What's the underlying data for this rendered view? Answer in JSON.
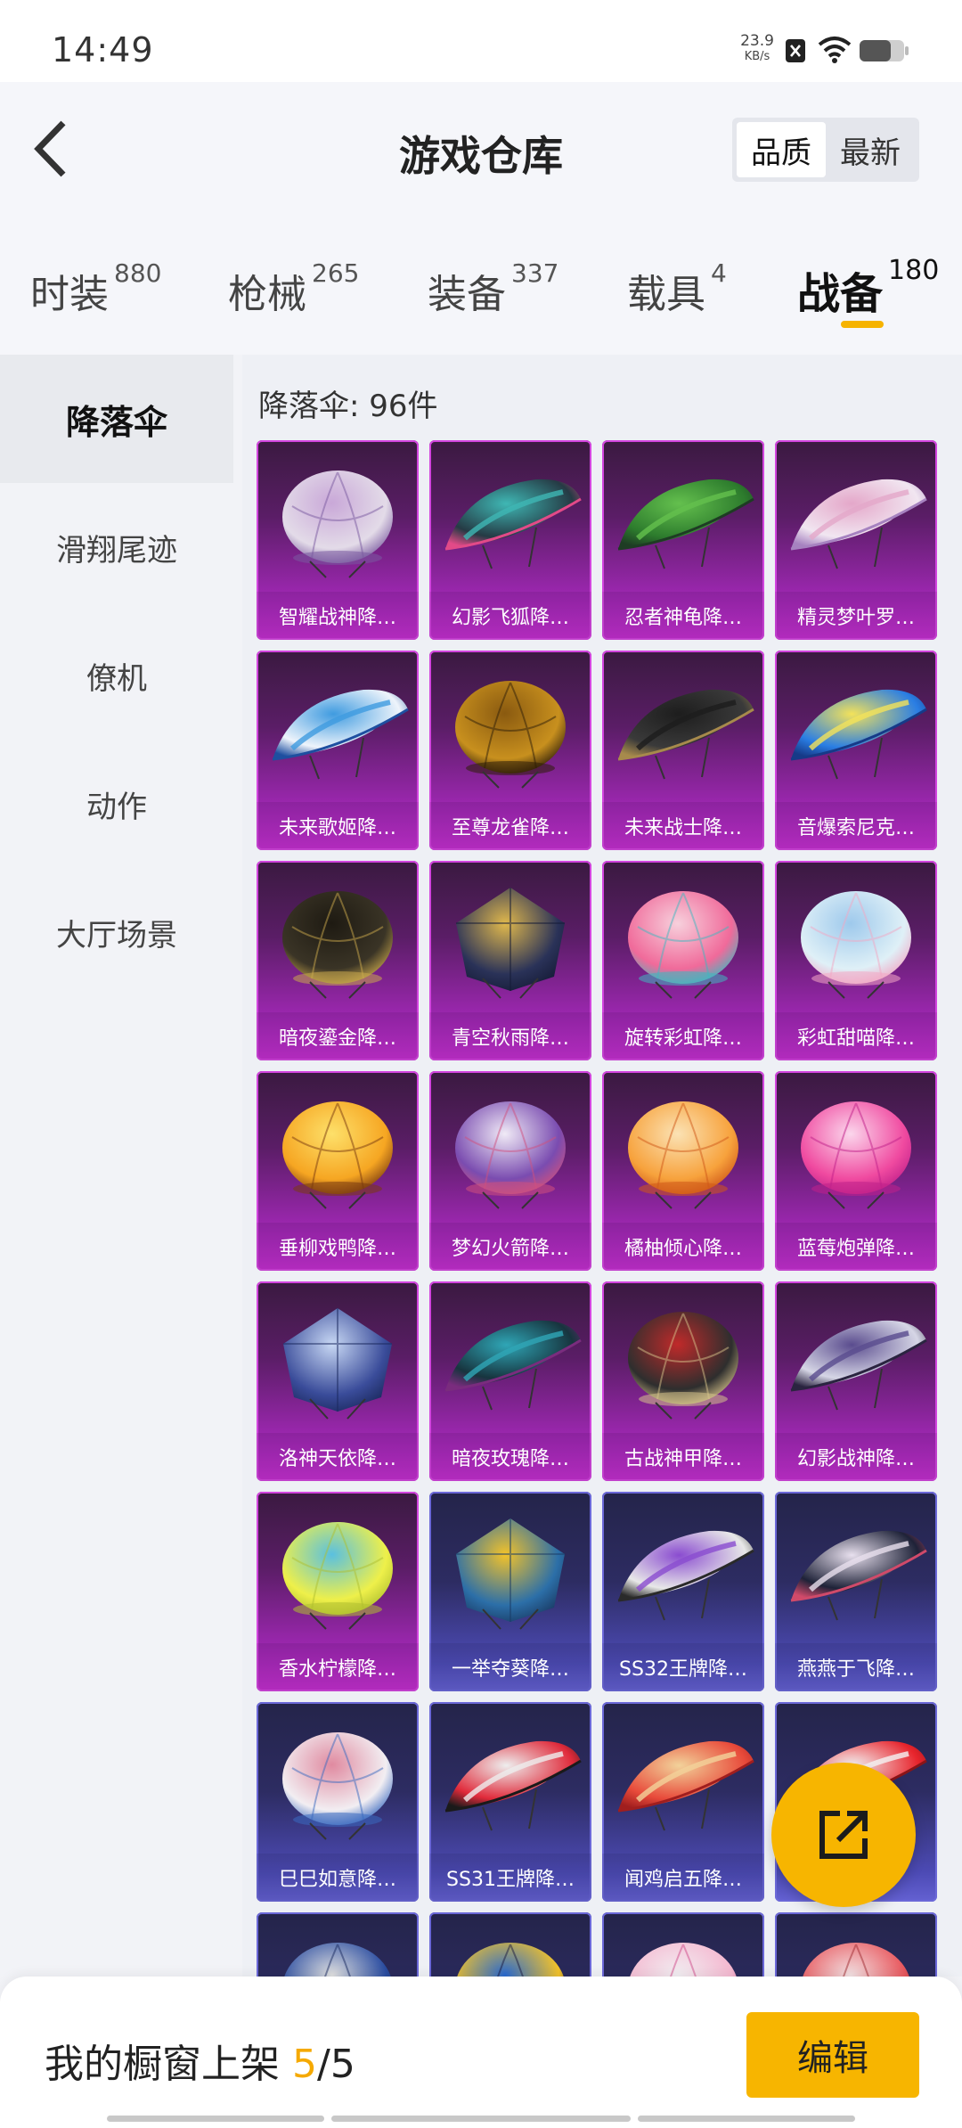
{
  "status_bar": {
    "time": "14:49",
    "net_speed_value": "23.9",
    "net_speed_unit": "KB/s",
    "battery_level": 0.7
  },
  "header": {
    "title": "游戏仓库",
    "sort_options": [
      "品质",
      "最新"
    ],
    "sort_active": "品质"
  },
  "tabs": [
    {
      "label": "时装",
      "count": "880"
    },
    {
      "label": "枪械",
      "count": "265"
    },
    {
      "label": "装备",
      "count": "337"
    },
    {
      "label": "载具",
      "count": "4"
    },
    {
      "label": "战备",
      "count": "180",
      "active": true
    }
  ],
  "sidebar": [
    {
      "label": "降落伞",
      "active": true
    },
    {
      "label": "滑翔尾迹"
    },
    {
      "label": "僚机"
    },
    {
      "label": "动作"
    },
    {
      "label": "大厅场景"
    }
  ],
  "content": {
    "count_label": "降落伞: 96件",
    "items": [
      {
        "label": "智耀战神降…",
        "tier": "epic",
        "shape": "round",
        "c1": "#e3dbe8",
        "c2": "#c9a8d8",
        "c3": "#7a5aa0"
      },
      {
        "label": "幻影飞狐降…",
        "tier": "epic",
        "shape": "wing",
        "c1": "#253a44",
        "c2": "#3fb7b4",
        "c3": "#e24a88"
      },
      {
        "label": "忍者神龟降…",
        "tier": "epic",
        "shape": "wing",
        "c1": "#2d7c2d",
        "c2": "#64c04e",
        "c3": "#1e3c24"
      },
      {
        "label": "精灵梦叶罗…",
        "tier": "epic",
        "shape": "wing",
        "c1": "#f1e6f1",
        "c2": "#e4a7c9",
        "c3": "#a682c0"
      },
      {
        "label": "未来歌姬降…",
        "tier": "epic",
        "shape": "wing",
        "c1": "#eef4fb",
        "c2": "#3f9be0",
        "c3": "#1e4fa0"
      },
      {
        "label": "至尊龙雀降…",
        "tier": "epic",
        "shape": "round",
        "c1": "#c8901e",
        "c2": "#8a5a10",
        "c3": "#2d1d08"
      },
      {
        "label": "未来战士降…",
        "tier": "epic",
        "shape": "wing",
        "c1": "#3a3a3a",
        "c2": "#1d1d1d",
        "c3": "#a78a4c"
      },
      {
        "label": "音爆索尼克…",
        "tier": "epic",
        "shape": "wing",
        "c1": "#2a7ee4",
        "c2": "#f3e25a",
        "c3": "#163a88"
      },
      {
        "label": "暗夜鎏金降…",
        "tier": "epic",
        "shape": "round",
        "c1": "#3a3426",
        "c2": "#1e1a12",
        "c3": "#c9a84c"
      },
      {
        "label": "青空秋雨降…",
        "tier": "epic",
        "shape": "square",
        "c1": "#2a3258",
        "c2": "#e0b84c",
        "c3": "#161c38"
      },
      {
        "label": "旋转彩虹降…",
        "tier": "epic",
        "shape": "round",
        "c1": "#f06a9a",
        "c2": "#f7d0dc",
        "c3": "#3fb7c0"
      },
      {
        "label": "彩虹甜喵降…",
        "tier": "epic",
        "shape": "round",
        "c1": "#dff0f7",
        "c2": "#9ec9ec",
        "c3": "#f2a8c4"
      },
      {
        "label": "垂柳戏鸭降…",
        "tier": "epic",
        "shape": "round",
        "c1": "#f6a622",
        "c2": "#fde06a",
        "c3": "#7a3a10"
      },
      {
        "label": "梦幻火箭降…",
        "tier": "epic",
        "shape": "round",
        "c1": "#7a4cb0",
        "c2": "#f0eaf6",
        "c3": "#d0507e"
      },
      {
        "label": "橘柚倾心降…",
        "tier": "epic",
        "shape": "round",
        "c1": "#f7a23c",
        "c2": "#fbe2b4",
        "c3": "#d05818"
      },
      {
        "label": "蓝莓炮弹降…",
        "tier": "epic",
        "shape": "round",
        "c1": "#f04aa0",
        "c2": "#fbd6ec",
        "c3": "#c0208a"
      },
      {
        "label": "洛神天依降…",
        "tier": "epic",
        "shape": "square",
        "c1": "#3a4c9a",
        "c2": "#c8d8f4",
        "c3": "#1c2a60"
      },
      {
        "label": "暗夜玫瑰降…",
        "tier": "epic",
        "shape": "wing",
        "c1": "#17343e",
        "c2": "#2fa6b6",
        "c3": "#7a2c7e"
      },
      {
        "label": "古战神甲降…",
        "tier": "epic",
        "shape": "round",
        "c1": "#2e2e2e",
        "c2": "#c02a2a",
        "c3": "#d6c28a"
      },
      {
        "label": "幻影战神降…",
        "tier": "epic",
        "shape": "wing",
        "c1": "#d6d6e6",
        "c2": "#5a4c8e",
        "c3": "#2a2440"
      },
      {
        "label": "香水柠檬降…",
        "tier": "epic",
        "shape": "round",
        "c1": "#eef04a",
        "c2": "#5ac0e0",
        "c3": "#b0c030"
      },
      {
        "label": "一举夺葵降…",
        "tier": "legend",
        "shape": "square",
        "c1": "#2c6fa8",
        "c2": "#f2c22a",
        "c3": "#1a3c66"
      },
      {
        "label": "SS32王牌降…",
        "tier": "legend",
        "shape": "wing",
        "c1": "#e8e8e8",
        "c2": "#8a4cd0",
        "c3": "#2a2a2a"
      },
      {
        "label": "燕燕于飞降…",
        "tier": "legend",
        "shape": "wing",
        "c1": "#1e2238",
        "c2": "#e8e0ee",
        "c3": "#d04a6a"
      },
      {
        "label": "巳巳如意降…",
        "tier": "legend",
        "shape": "round",
        "c1": "#f2eef2",
        "c2": "#e08aa0",
        "c3": "#3a6ac0"
      },
      {
        "label": "SS31王牌降…",
        "tier": "legend",
        "shape": "wing",
        "c1": "#e02a3a",
        "c2": "#eeeeee",
        "c3": "#1a1a1a"
      },
      {
        "label": "闻鸡启五降…",
        "tier": "legend",
        "shape": "wing",
        "c1": "#e84a3a",
        "c2": "#f2d29a",
        "c3": "#a01e1e"
      },
      {
        "label": "",
        "tier": "legend",
        "shape": "wing",
        "c1": "#e8242c",
        "c2": "#f4f4f4",
        "c3": "#8a1418"
      },
      {
        "label": "",
        "tier": "legend",
        "shape": "round",
        "c1": "#2a4ca0",
        "c2": "#e0e0e0",
        "c3": "#1a2a60"
      },
      {
        "label": "",
        "tier": "legend",
        "shape": "round",
        "c1": "#f2c22a",
        "c2": "#2a6ad0",
        "c3": "#1a1a40"
      },
      {
        "label": "",
        "tier": "legend",
        "shape": "round",
        "c1": "#f4b8d0",
        "c2": "#f2eef2",
        "c3": "#d04a8a"
      },
      {
        "label": "",
        "tier": "legend",
        "shape": "round",
        "c1": "#e8585e",
        "c2": "#f2e0e2",
        "c3": "#a02a30"
      }
    ]
  },
  "footer": {
    "showcase_label": "我的橱窗上架",
    "showcase_current": "5",
    "showcase_separator": "/",
    "showcase_total": "5",
    "edit_label": "编辑"
  },
  "colors": {
    "accent": "#f7b500",
    "epic_card": "#a028b4",
    "legend_card": "#4c4ab4"
  },
  "icons": {
    "back": "chevron-left-icon",
    "share": "share-external-icon",
    "wifi": "wifi-icon",
    "battery": "battery-icon",
    "notification_muted": "notification-x-icon"
  }
}
